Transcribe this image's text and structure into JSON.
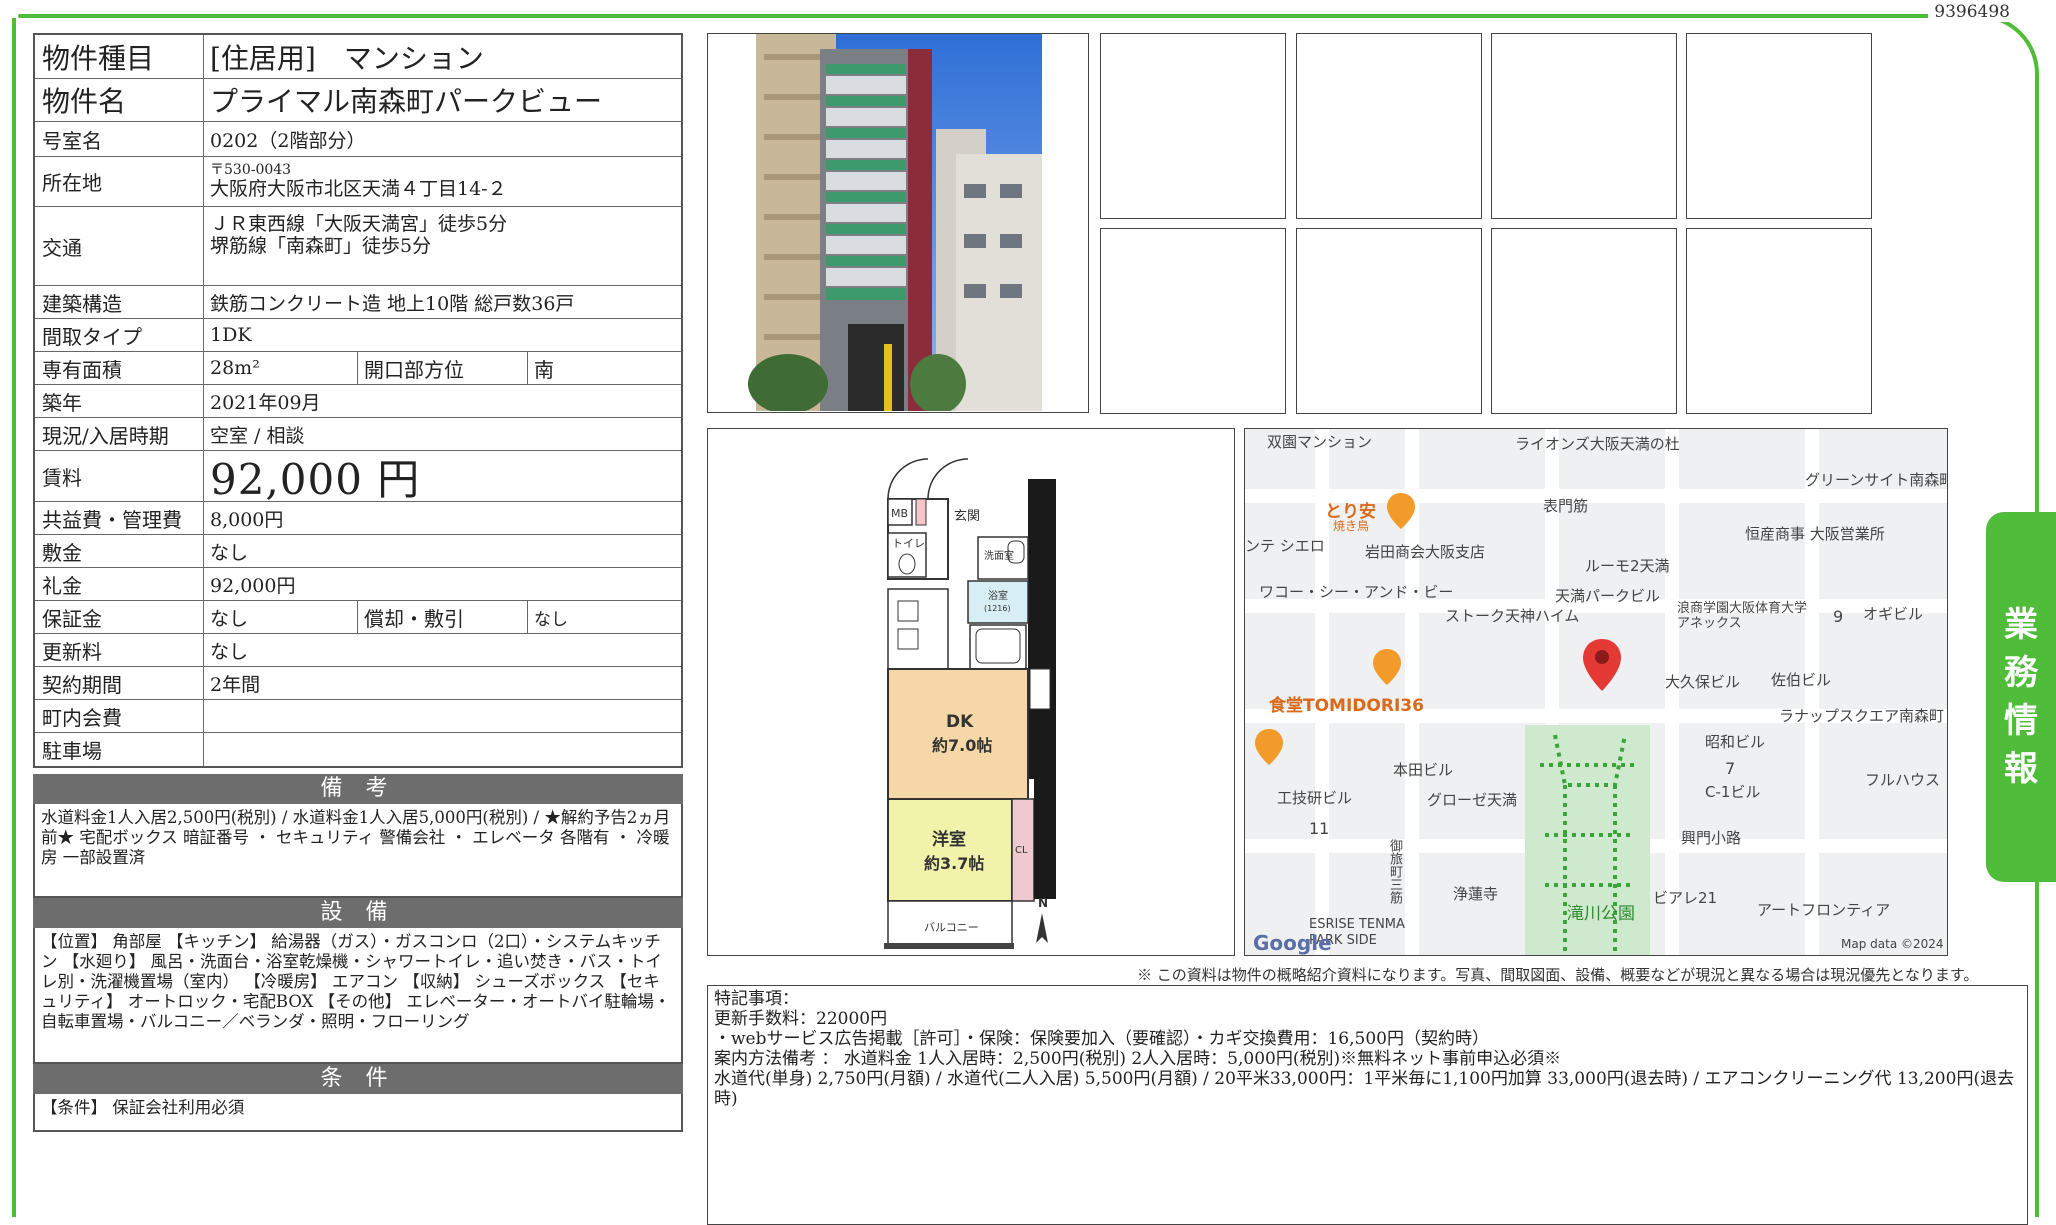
{
  "doc_id": "9396498",
  "side_tab": [
    "業",
    "務",
    "情",
    "報"
  ],
  "property": {
    "type_label": "物件種目",
    "type_value": "[住居用]　マンション",
    "name_label": "物件名",
    "name_value": "プライマル南森町パークビュー",
    "room_label": "号室名",
    "room_value": "0202（2階部分）",
    "address_label": "所在地",
    "postal": "〒530-0043",
    "address": "大阪府大阪市北区天満４丁目14-２",
    "access_label": "交通",
    "access_1": "ＪＲ東西線「大阪天満宮」徒歩5分",
    "access_2": "堺筋線「南森町」徒歩5分",
    "structure_label": "建築構造",
    "structure_value": "鉄筋コンクリート造 地上10階 総戸数36戸",
    "layout_label": "間取タイプ",
    "layout_value": "1DK",
    "area_label": "専有面積",
    "area_value": "28m²",
    "opening_label": "開口部方位",
    "opening_value": "南",
    "built_label": "築年",
    "built_value": "2021年09月",
    "status_label": "現況/入居時期",
    "status_value": "空室 / 相談",
    "rent_label": "賃料",
    "rent_value": "92,000 円",
    "fee_label": "共益費・管理費",
    "fee_value": "8,000円",
    "deposit_label": "敷金",
    "deposit_value": "なし",
    "keymoney_label": "礼金",
    "keymoney_value": "92,000円",
    "guarantee_label": "保証金",
    "guarantee_value": "なし",
    "amort_label": "償却・敷引",
    "amort_value": "なし",
    "renewal_label": "更新料",
    "renewal_value": "なし",
    "contract_label": "契約期間",
    "contract_value": "2年間",
    "town_label": "町内会費",
    "town_value": "",
    "parking_label": "駐車場",
    "parking_value": ""
  },
  "sections": {
    "notes_title": "備 考",
    "notes_text": "水道料金1人入居2,500円(税別) / 水道料金1人入居5,000円(税別) / ★解約予告2ヵ月前★ 宅配ボックス 暗証番号 ・ セキュリティ 警備会社 ・ エレベータ 各階有 ・ 冷暖房 一部設置済",
    "facilities_title": "設 備",
    "facilities_text": "【位置】 角部屋 【キッチン】 給湯器（ガス）・ガスコンロ（2口）・システムキッチン 【水廻り】 風呂・洗面台・浴室乾燥機・シャワートイレ・追い焚き・バス・トイレ別・洗濯機置場（室内） 【冷暖房】 エアコン 【収納】 シューズボックス 【セキュリティ】 オートロック・宅配BOX 【その他】 エレベーター・オートバイ駐輪場・自転車置場・バルコニー／ベランダ・照明・フローリング",
    "conditions_title": "条 件",
    "conditions_text": "【条件】 保証会社利用必須"
  },
  "floorplan": {
    "mb": "MB",
    "entrance": "玄関",
    "toilet": "トイレ",
    "washroom": "洗面室",
    "bath": "浴室",
    "bath_size": "(1216)",
    "dk": "DK",
    "dk_size": "約7.0帖",
    "western": "洋室",
    "western_size": "約3.7帖",
    "cl": "CL",
    "balcony": "バルコニー",
    "north": "N"
  },
  "map": {
    "labels": [
      "双園マンション",
      "ライオンズ大阪天満の杜",
      "グリーンサイト南森町",
      "とり安",
      "焼き鳥",
      "表門筋",
      "恒産商事 大阪営業所",
      "ンテ シエロ",
      "岩田商会大阪支店",
      "ルーモ2天満",
      "ワコー・シー・アンド・ビー",
      "天満パークビル",
      "浪商学園大阪体育大学アネックス",
      "オギビル",
      "ストーク天神ハイム",
      "9",
      "大久保ビル",
      "佐伯ビル",
      "食堂TOMIDORI36",
      "ラナップスクエア南森町",
      "昭和ビル",
      "本田ビル",
      "7",
      "フルハウス",
      "工技研ビル",
      "グローゼ天満",
      "C-1ビル",
      "11",
      "興門小路",
      "御旅町三筋",
      "浄蓮寺",
      "ビアレ21",
      "アートフロンティア",
      "滝川公園",
      "ESRISE TENMA PARK SIDE",
      "Google",
      "Map data ©2024"
    ]
  },
  "footnote": "※ この資料は物件の概略紹介資料になります。写真、間取図面、設備、概要などが現況と異なる場合は現況優先となります。",
  "remarks": {
    "line1": "特記事項：",
    "line2": "更新手数料：22000円",
    "line3": "・webサービス広告掲載［許可］・保険：保険要加入（要確認）・カギ交換費用：16,500円（契約時）",
    "line4": "案内方法備考 ： 水道料金 1人入居時：2,500円(税別) 2人入居時：5,000円(税別)※無料ネット事前申込必須※",
    "line5": "水道代(単身) 2,750円(月額) / 水道代(二人入居) 5,500円(月額) / 20平米33,000円：1平米毎に1,100円加算 33,000円(退去時) / エアコンクリーニング代 13,200円(退去時)"
  }
}
